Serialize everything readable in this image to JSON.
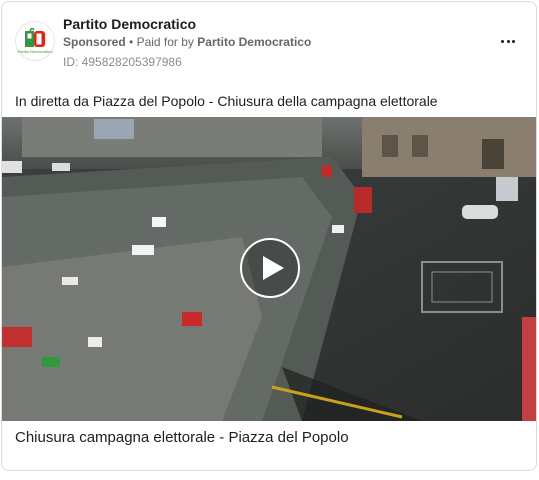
{
  "post": {
    "page_name": "Partito Democratico",
    "sponsored_label": "Sponsored",
    "separator": "•",
    "paid_for_prefix": "Paid for by",
    "paid_for_by": "Partito Democratico",
    "ad_id": "ID: 495828205397986",
    "caption": "In diretta da Piazza del Popolo - Chiusura della campagna elettorale",
    "video_title": "Chiusura campagna elettorale - Piazza del Popolo",
    "logo_text": "Partito Democratico"
  },
  "icons": {
    "more": "more-options-icon",
    "play": "play-icon"
  },
  "colors": {
    "pd_green": "#2e9a3c",
    "pd_red": "#e2231a",
    "text_primary": "#1c1e21",
    "text_secondary": "#65676b"
  }
}
